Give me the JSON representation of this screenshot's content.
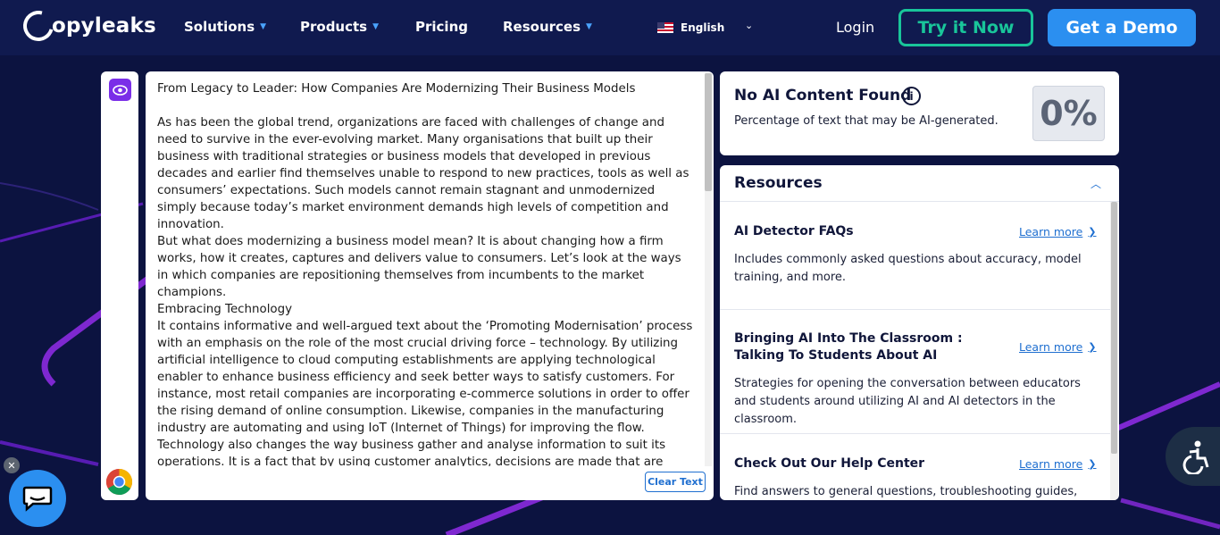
{
  "nav": {
    "logo_text": "opyleaks",
    "items": [
      {
        "label": "Solutions",
        "has_caret": true
      },
      {
        "label": "Products",
        "has_caret": true
      },
      {
        "label": "Pricing",
        "has_caret": false
      },
      {
        "label": "Resources",
        "has_caret": true
      }
    ],
    "language": "English",
    "login": "Login",
    "try_now": "Try it Now",
    "get_demo": "Get a Demo"
  },
  "editor": {
    "title": "From Legacy to Leader: How Companies Are Modernizing Their Business Models",
    "paragraphs": [
      "As has been the global trend, organizations are faced with challenges of change and need to survive in the ever-evolving market. Many organisations that built up their business with traditional strategies or business models that developed in previous decades and earlier find themselves unable to respond to new practices, tools as well as consumers’ expectations. Such models cannot remain stagnant and unmodernized simply because today’s market environment demands high levels of competition and innovation.",
      "But what does modernizing a business model mean? It is about changing how a firm works, how it creates, captures and delivers value to consumers. Let’s look at the ways in which companies are repositioning themselves from incumbents to the market champions.",
      "Embracing Technology",
      "It contains informative and well-argued text about the ‘Promoting Modernisation’ process with an emphasis on the role of the most crucial driving force – technology. By utilizing artificial intelligence to cloud computing establishments are applying technological enabler to enhance business efficiency and seek better ways to satisfy customers. For instance, most retail companies are incorporating e-commerce solutions in order to offer the rising demand of online consumption. Likewise, companies in the manufacturing industry are automating and using IoT (Internet of Things) for improving the flow.",
      "Technology also changes the way business gather and analyse information to suit its operations. It is a fact that by using customer analytics, decisions are made that are more informed, solutions to offer services are better tailored to demand and future market"
    ],
    "clear_label": "Clear Text"
  },
  "result": {
    "title": "No AI Content Found",
    "subtitle": "Percentage of text that may be AI-generated.",
    "percent": "0%"
  },
  "resources": {
    "title": "Resources",
    "items": [
      {
        "title": "AI Detector FAQs",
        "link": "Learn more",
        "desc": "Includes commonly asked questions about accuracy, model training, and more."
      },
      {
        "title": "Bringing AI Into The Classroom : Talking To Students About AI",
        "link": "Learn more",
        "desc": "Strategies for opening the conversation between educators and students around utilizing AI and AI detectors in the classroom."
      },
      {
        "title": "Check Out Our Help Center",
        "link": "Learn more",
        "desc": "Find answers to general questions, troubleshooting guides, and"
      }
    ]
  },
  "colors": {
    "background": "#0c1340",
    "nav_bg": "#101a4f",
    "accent_green": "#19c59a",
    "accent_blue": "#2b8ff0",
    "accent_purple": "#7a2ee8"
  },
  "icons": {
    "eye": "eye-icon",
    "chrome": "chrome-icon",
    "info": "info-icon",
    "chat": "chat-icon",
    "accessibility": "accessibility-icon"
  }
}
